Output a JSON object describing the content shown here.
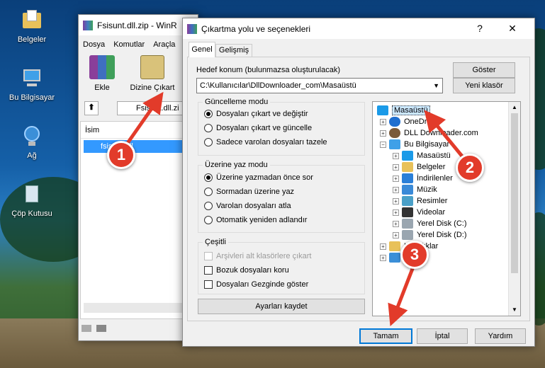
{
  "desktop": {
    "icons": [
      {
        "label": "Belgeler"
      },
      {
        "label": "Bu Bilgisayar"
      },
      {
        "label": "Ağ"
      },
      {
        "label": "Çöp Kutusu"
      }
    ]
  },
  "winrar": {
    "title": "Fsisunt.dll.zip - WinR",
    "menu": [
      "Dosya",
      "Komutlar",
      "Araçla"
    ],
    "toolbar": {
      "add": "Ekle",
      "extract_to": "Dizine Çıkart"
    },
    "path": "Fsisunt.dll.zi",
    "column_name": "İsim",
    "file_name": "fsisunt.dll"
  },
  "dialog": {
    "title": "Çıkartma yolu ve seçenekleri",
    "help_btn": "?",
    "close_btn": "✕",
    "tabs": [
      "Genel",
      "Gelişmiş"
    ],
    "dest_label": "Hedef konum (bulunmazsa oluşturulacak)",
    "dest_value": "C:\\Kullanıcılar\\DllDownloader_com\\Masaüstü",
    "show_btn": "Göster",
    "new_folder_btn": "Yeni klasör",
    "update_mode": {
      "legend": "Güncelleme modu",
      "options": [
        "Dosyaları çıkart ve değiştir",
        "Dosyaları çıkart ve güncelle",
        "Sadece varolan dosyaları tazele"
      ],
      "selected": 0
    },
    "overwrite_mode": {
      "legend": "Üzerine yaz modu",
      "options": [
        "Üzerine yazmadan önce sor",
        "Sormadan üzerine yaz",
        "Varolan dosyaları atla",
        "Otomatik yeniden adlandır"
      ],
      "selected": 0
    },
    "misc": {
      "legend": "Çeşitli",
      "options": [
        "Arşivleri alt klasörlere çıkart",
        "Bozuk dosyaları koru",
        "Dosyaları Gezginde göster"
      ]
    },
    "save_settings_btn": "Ayarları kaydet",
    "tree": [
      "Masaüstü",
      "OneDrive",
      "DLL Downloader.com",
      "Bu Bilgisayar",
      "Masaüstü",
      "Belgeler",
      "İndirilenler",
      "Müzik",
      "Resimler",
      "Videolar",
      "Yerel Disk (C:)",
      "Yerel Disk (D:)",
      "Kitaplıklar",
      "Ağ"
    ],
    "ok_btn": "Tamam",
    "cancel_btn": "İptal",
    "help_bottom_btn": "Yardım"
  },
  "annotations": [
    "1",
    "2",
    "3"
  ],
  "colors": {
    "arrow": "#e23b2a",
    "selection": "#cce8ff",
    "accent": "#0078d7"
  }
}
